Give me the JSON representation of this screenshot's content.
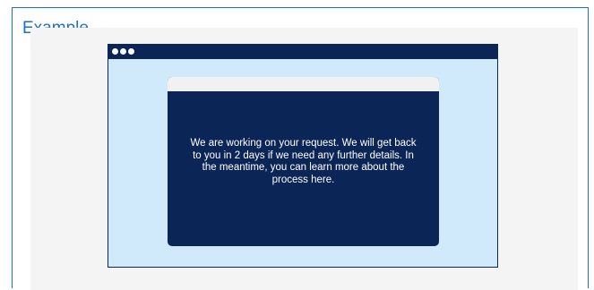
{
  "label": "Example",
  "browser": {
    "window_dots": [
      "dot",
      "dot",
      "dot"
    ]
  },
  "modal": {
    "message": "We are working on your request. We will get back to you in 2 days if we need any further details. In the meantime, you can learn more about the process here."
  },
  "colors": {
    "accent": "#1f6fc9",
    "navy": "#0c2557",
    "browser_background": "#d0e9fb",
    "canvas_background": "#f4f4f5"
  }
}
